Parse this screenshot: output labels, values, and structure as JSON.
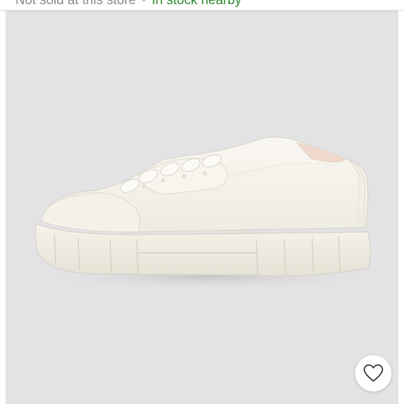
{
  "availability": {
    "store_status": "Not sold at this store",
    "nearby_status": "In stock nearby"
  },
  "product_image": {
    "alt": "White canvas platform lace-up sneaker, side view"
  },
  "favorite": {
    "label": "Add to favorites",
    "icon": "heart-outline-icon",
    "saved": false
  },
  "colors": {
    "background": "#e3e3e5",
    "in_stock_green": "#2e8a2e",
    "muted_text": "#888888"
  }
}
